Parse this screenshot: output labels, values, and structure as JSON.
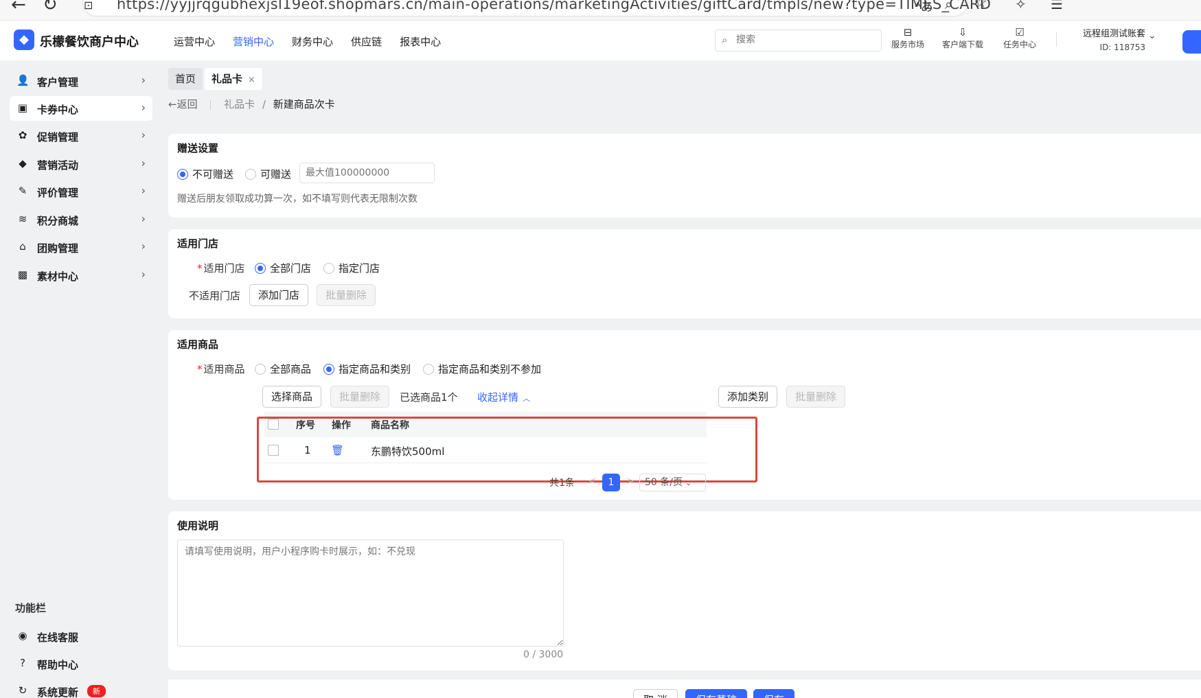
{
  "browser": {
    "url": "https://yyjjrqgubhexjsl19eof.shopmars.cn/main-operations/marketingActivities/giftCard/tmpls/new?type=TIMES_CARD"
  },
  "header": {
    "logo_mark": "◆",
    "brand": "乐檬餐饮商户中心",
    "nav": [
      "运营中心",
      "营销中心",
      "财务中心",
      "供应链",
      "报表中心"
    ],
    "active_nav": "营销中心",
    "search_placeholder": "搜索",
    "tools": [
      {
        "label": "服务市场",
        "icon": "store-icon"
      },
      {
        "label": "客户端下载",
        "icon": "download-icon"
      },
      {
        "label": "任务中心",
        "icon": "task-icon"
      }
    ],
    "account_name": "远程组测试账套",
    "account_id": "ID: 118753"
  },
  "sidebar": {
    "items": [
      {
        "label": "客户管理",
        "icon": "user-icon"
      },
      {
        "label": "卡券中心",
        "icon": "card-icon"
      },
      {
        "label": "促销管理",
        "icon": "gear-icon"
      },
      {
        "label": "营销活动",
        "icon": "tag-icon"
      },
      {
        "label": "评价管理",
        "icon": "edit-icon"
      },
      {
        "label": "积分商城",
        "icon": "coins-icon"
      },
      {
        "label": "团购管理",
        "icon": "shop-icon"
      },
      {
        "label": "素材中心",
        "icon": "image-icon"
      }
    ],
    "active_item": "卡券中心",
    "func_title": "功能栏",
    "func_items": [
      {
        "label": "在线客服",
        "icon": "chat-icon"
      },
      {
        "label": "帮助中心",
        "icon": "help-icon"
      },
      {
        "label": "系统更新",
        "icon": "refresh-icon",
        "badge": "新"
      }
    ]
  },
  "tabs": {
    "home": "首页",
    "current": "礼品卡",
    "close": "×"
  },
  "breadcrumb": {
    "back": "返回",
    "parent": "礼品卡",
    "separator": "/",
    "current": "新建商品次卡"
  },
  "gift_settings": {
    "title": "赠送设置",
    "option_no": "不可赠送",
    "option_yes": "可赠送",
    "selected": "不可赠送",
    "max_placeholder": "最大值100000000",
    "hint": "赠送后朋友领取成功算一次，如不填写则代表无限制次数"
  },
  "stores": {
    "title": "适用门店",
    "label": "适用门店",
    "option_all": "全部门店",
    "option_specified": "指定门店",
    "selected": "全部门店",
    "excluded_label": "不适用门店",
    "add_button": "添加门店",
    "batch_delete": "批量删除"
  },
  "products": {
    "title": "适用商品",
    "label": "适用商品",
    "options": [
      "全部商品",
      "指定商品和类别",
      "指定商品和类别不参加"
    ],
    "selected": "指定商品和类别",
    "select_button": "选择商品",
    "batch_delete": "批量删除",
    "selected_count": "已选商品1个",
    "collapse_link": "收起详情",
    "add_category": "添加类别",
    "batch_delete_2": "批量删除",
    "table": {
      "headers": [
        "序号",
        "操作",
        "商品名称"
      ],
      "rows": [
        {
          "index": "1",
          "name": "东鹏特饮500ml"
        }
      ]
    },
    "pager": {
      "total": "共1条",
      "prev": "<",
      "page": "1",
      "next": ">",
      "page_size": "50 条/页"
    }
  },
  "usage": {
    "title": "使用说明",
    "placeholder": "请填写使用说明，用户小程序购卡时展示，如：不兑现",
    "counter": "0 / 3000"
  },
  "footer": {
    "cancel": "取 消",
    "save_draft": "保存草稿",
    "save": "保存"
  },
  "colors": {
    "primary": "#3366ff",
    "highlight_box": "#e0453c",
    "badge_red": "#f02020"
  }
}
